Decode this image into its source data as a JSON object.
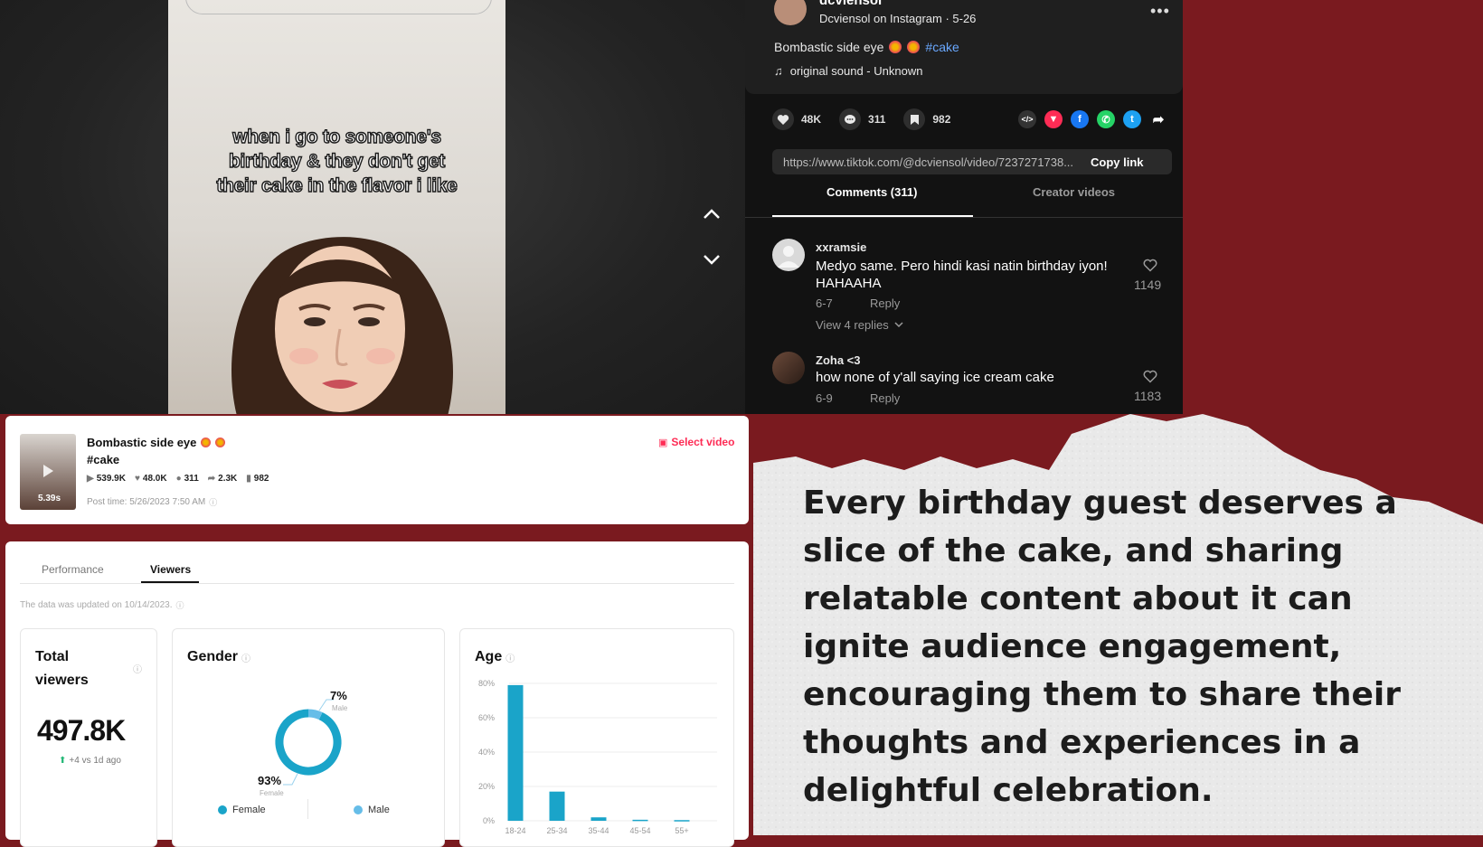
{
  "video": {
    "caption_lines": [
      "when i go to someone's",
      "birthday & they don't get",
      "their cake in the flavor i like"
    ]
  },
  "tiktok": {
    "username": "dcviensol",
    "source_line": "Dcviensol on Instagram · 5-26",
    "description": "Bombastic side eye",
    "hashtag": "#cake",
    "sound": "original sound - Unknown",
    "likes": "48K",
    "comments": "311",
    "saves": "982",
    "link": "https://www.tiktok.com/@dcviensol/video/7237271738...",
    "copy_link": "Copy link",
    "tab_comments": "Comments (311)",
    "tab_creator": "Creator videos",
    "comment_list": [
      {
        "user": "xxramsie",
        "text": "Medyo same. Pero hindi kasi natin birthday iyon! HAHAAHA",
        "date": "6-7",
        "reply": "Reply",
        "likes": "1149",
        "view_replies": "View 4 replies"
      },
      {
        "user": "Zoha <3",
        "text": "how none of y'all saying ice cream cake",
        "date": "6-9",
        "reply": "Reply",
        "likes": "1183"
      }
    ]
  },
  "analytics": {
    "video_title": "Bombastic side eye",
    "video_tag": "#cake",
    "duration": "5.39s",
    "select_video": "Select video",
    "stats": {
      "plays": "539.9K",
      "likes": "48.0K",
      "comments": "311",
      "shares": "2.3K",
      "saves": "982"
    },
    "post_time": "Post time: 5/26/2023 7:50 AM",
    "tabs": [
      "Performance",
      "Viewers"
    ],
    "updated": "The data was updated on 10/14/2023.",
    "total_viewers_title_1": "Total",
    "total_viewers_title_2": "viewers",
    "total_viewers": "497.8K",
    "total_delta": "+4 vs 1d ago",
    "gender_title": "Gender",
    "gender_female_pct": "93%",
    "gender_female_label": "Female",
    "gender_male_pct": "7%",
    "gender_male_label": "Male",
    "legend_female": "Female",
    "legend_male": "Male",
    "age_title": "Age"
  },
  "chart_data": {
    "type": "bar",
    "categories": [
      "18-24",
      "25-34",
      "35-44",
      "45-54",
      "55+"
    ],
    "values": [
      79,
      17,
      2,
      0.6,
      0.4
    ],
    "ylim": [
      0,
      80
    ],
    "yticks": [
      "0%",
      "20%",
      "40%",
      "60%",
      "80%"
    ],
    "grid": true,
    "color": "#1aa4c9"
  },
  "donut": {
    "female": 93,
    "male": 7,
    "female_color": "#1aa4c9",
    "male_color": "#66bde8"
  },
  "paper": {
    "text": "Every birthday guest deserves a slice of the cake, and sharing relatable content about it can ignite audience engagement, encouraging them to share their thoughts and experiences in a delightful celebration."
  },
  "colors": {
    "background": "#7a1a1f",
    "accent": "#fe2c55"
  }
}
